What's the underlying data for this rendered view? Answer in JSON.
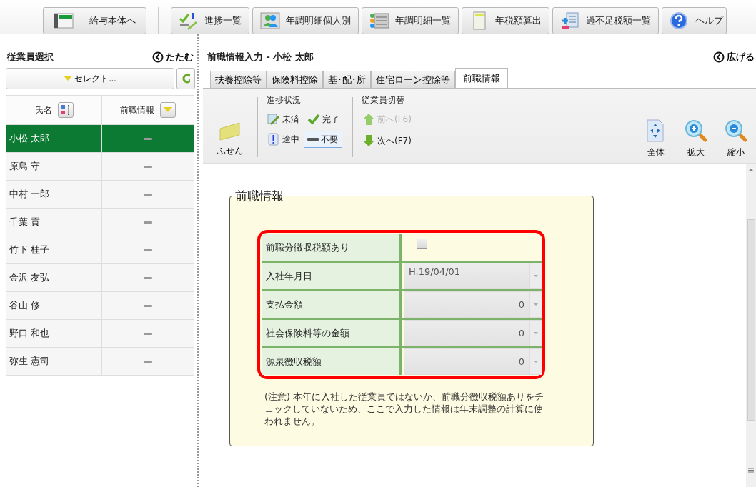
{
  "toolbar": [
    {
      "label": "給与本体へ"
    },
    {
      "label": "進捗一覧"
    },
    {
      "label": "年調明細個人別"
    },
    {
      "label": "年調明細一覧"
    },
    {
      "label": "年税額算出"
    },
    {
      "label": "過不足税額一覧"
    },
    {
      "label": "ヘルプ"
    }
  ],
  "sidebar": {
    "title": "従業員選択",
    "collapse": "たたむ",
    "select": {
      "value": "セレクト..."
    },
    "columns": [
      "氏名",
      "前職情報"
    ],
    "rows": [
      {
        "name": "小松 太郎",
        "not_required": true,
        "selected": true
      },
      {
        "name": "原島 守",
        "not_required": true,
        "selected": false
      },
      {
        "name": "中村 一郎",
        "not_required": true,
        "selected": false
      },
      {
        "name": "千葉 貢",
        "not_required": true,
        "selected": false
      },
      {
        "name": "竹下 桂子",
        "not_required": true,
        "selected": false
      },
      {
        "name": "金沢 友弘",
        "not_required": true,
        "selected": false
      },
      {
        "name": "谷山 修",
        "not_required": true,
        "selected": false
      },
      {
        "name": "野口 和也",
        "not_required": true,
        "selected": false
      },
      {
        "name": "弥生 憲司",
        "not_required": true,
        "selected": false
      }
    ]
  },
  "main": {
    "title": "前職情報入力 - 小松 太郎",
    "expand": "広げる",
    "tabs": [
      {
        "label": "扶養控除等",
        "selected": false
      },
      {
        "label": "保険料控除",
        "selected": false
      },
      {
        "label": "基･配･所",
        "selected": false
      },
      {
        "label": "住宅ローン控除等",
        "selected": false
      },
      {
        "label": "前職情報",
        "selected": true
      }
    ],
    "ribbon": {
      "sticky": "ふせん",
      "progress_title": "進捗状況",
      "progress": [
        {
          "label": "未済",
          "kind": "pending",
          "selected": false
        },
        {
          "label": "完了",
          "kind": "done",
          "selected": false
        },
        {
          "label": "途中",
          "kind": "partial",
          "selected": false
        },
        {
          "label": "不要",
          "kind": "unneeded",
          "selected": true
        }
      ],
      "switch_title": "従業員切替",
      "switch": [
        {
          "label": "前へ(F6)",
          "kind": "prev",
          "disabled": true
        },
        {
          "label": "次へ(F7)",
          "kind": "next",
          "disabled": false
        }
      ],
      "view": [
        {
          "label": "全体",
          "kind": "fit"
        },
        {
          "label": "拡大",
          "kind": "zoom-in"
        },
        {
          "label": "縮小",
          "kind": "zoom-out"
        }
      ]
    },
    "group": {
      "title": "前職情報",
      "fields": [
        {
          "label": "前職分徴収税額あり",
          "kind": "checkbox",
          "checked": false
        },
        {
          "label": "入社年月日",
          "kind": "date",
          "value": "H.19/04/01"
        },
        {
          "label": "支払金額",
          "kind": "amount",
          "value": "0"
        },
        {
          "label": "社会保険料等の金額",
          "kind": "amount",
          "value": "0"
        },
        {
          "label": "源泉徴収税額",
          "kind": "amount",
          "value": "0"
        }
      ],
      "note": "(注意) 本年に入社した従業員ではないか、前職分徴収税額ありをチェックしていないため、ここで入力した情報は年末調整の計算に使われません。"
    }
  }
}
